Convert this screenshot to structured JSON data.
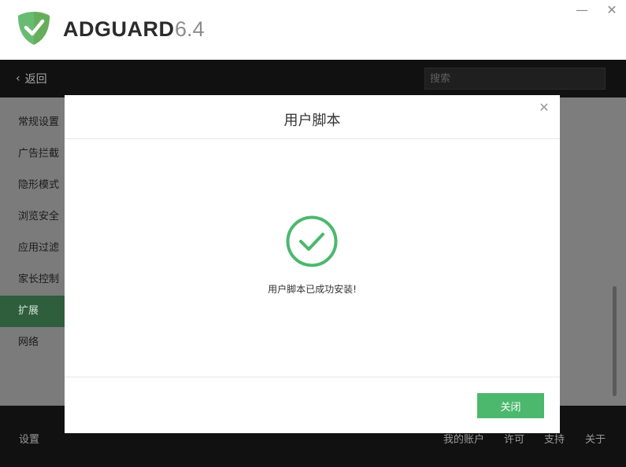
{
  "app": {
    "name": "ADGUARD",
    "version": "6.4",
    "brand_color": "#68bc71"
  },
  "window_controls": {
    "minimize": "—",
    "close": "✕"
  },
  "header": {
    "back_label": "返回",
    "search_placeholder": "搜索"
  },
  "sidebar": {
    "items": [
      {
        "label": "常规设置",
        "active": false
      },
      {
        "label": "广告拦截",
        "active": false
      },
      {
        "label": "隐形模式",
        "active": false
      },
      {
        "label": "浏览安全",
        "active": false
      },
      {
        "label": "应用过滤",
        "active": false
      },
      {
        "label": "家长控制",
        "active": false
      },
      {
        "label": "扩展",
        "active": true
      },
      {
        "label": "网络",
        "active": false
      }
    ]
  },
  "footer": {
    "settings_label": "设置",
    "links": [
      "我的账户",
      "许可",
      "支持",
      "关于"
    ]
  },
  "modal": {
    "title": "用户脚本",
    "close_icon": "✕",
    "message": "用户脚本已成功安装!",
    "success_color": "#4bb86e",
    "close_button_label": "关闭"
  }
}
